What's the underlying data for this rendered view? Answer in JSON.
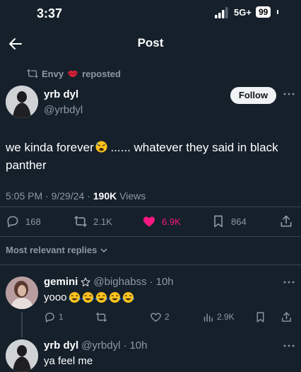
{
  "status_bar": {
    "time": "3:37",
    "network": "5G+",
    "battery": "99"
  },
  "topbar": {
    "title": "Post",
    "back_icon": "arrow-left-icon"
  },
  "repost": {
    "user": "Envy",
    "label": "reposted",
    "icon": "repost-icon"
  },
  "post": {
    "author_name": "yrb dyl",
    "author_handle": "@yrbdyl",
    "follow_label": "Follow",
    "text_part1": "we kinda forever",
    "text_part2": " ...... whatever they said in black panther",
    "time": "5:05 PM",
    "date": "9/29/24",
    "views_count": "190K",
    "views_label": "Views",
    "stats": {
      "replies": "168",
      "reposts": "2.1K",
      "likes": "6.9K",
      "bookmarks": "864"
    },
    "like_color": "#f91880"
  },
  "replies_filter": {
    "label": "Most relevant replies"
  },
  "replies": [
    {
      "name": "gemini",
      "handle": "@bighabss",
      "age": "10h",
      "text": "yooo",
      "emoji_count": 5,
      "stats": {
        "replies": "1",
        "reposts": "",
        "likes": "2",
        "views": "2.9K"
      }
    },
    {
      "name": "yrb dyl",
      "handle": "@yrbdyl",
      "age": "10h",
      "text": "ya feel me"
    }
  ],
  "colors": {
    "background": "#15202b",
    "text": "#e7e9ea",
    "muted": "#8b98a5",
    "divider": "#38444d"
  }
}
